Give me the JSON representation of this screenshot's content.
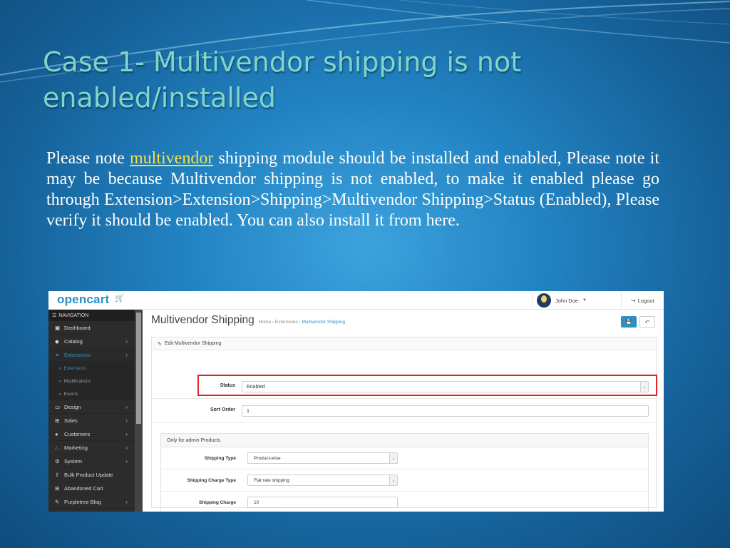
{
  "slide": {
    "title": "Case 1- Multivendor shipping is not enabled/installed",
    "body_before": "Please note ",
    "body_link": "multivendor",
    "body_after": " shipping module should be installed and enabled, Please note it may be because Multivendor shipping is not enabled, to make it enabled please go through Extension>Extension>Shipping>Multivendor Shipping>Status (Enabled), Please verify it should be enabled. You can also install it from here.",
    "link_color": "#f4e04d",
    "title_color": "#7fd6c8"
  },
  "app": {
    "logo": "opencart",
    "user_name": "John Doe",
    "logout_label": "Logout",
    "accent_color": "#2d90c8"
  },
  "sidebar": {
    "heading": "NAVIGATION",
    "items": [
      {
        "label": "Dashboard",
        "icon": "dashboard-icon",
        "arrow": false,
        "active": false
      },
      {
        "label": "Catalog",
        "icon": "tag-icon",
        "arrow": true,
        "active": false
      },
      {
        "label": "Extensions",
        "icon": "puzzle-icon",
        "arrow": true,
        "active": true
      },
      {
        "label": "Design",
        "icon": "monitor-icon",
        "arrow": true,
        "active": false
      },
      {
        "label": "Sales",
        "icon": "cart-icon",
        "arrow": true,
        "active": false
      },
      {
        "label": "Customers",
        "icon": "user-icon",
        "arrow": true,
        "active": false
      },
      {
        "label": "Marketing",
        "icon": "share-icon",
        "arrow": true,
        "active": false
      },
      {
        "label": "System",
        "icon": "cog-icon",
        "arrow": true,
        "active": false
      },
      {
        "label": "Bulk Product Update",
        "icon": "upload-icon",
        "arrow": false,
        "active": false
      },
      {
        "label": "Abandoned Cart",
        "icon": "cart-icon",
        "arrow": false,
        "active": false
      },
      {
        "label": "Purpletree Blog",
        "icon": "edit-icon",
        "arrow": true,
        "active": false
      }
    ],
    "subitems": [
      {
        "label": "Extensions",
        "active": true
      },
      {
        "label": "Modifications",
        "active": false
      },
      {
        "label": "Events",
        "active": false
      }
    ]
  },
  "page": {
    "title": "Multivendor Shipping",
    "breadcrumb": [
      "Home",
      "Extensions",
      "Multivendor Shipping"
    ],
    "panel_heading": "Edit Multivendor Shipping",
    "status_label": "Status",
    "status_value": "Enabled",
    "sort_order_label": "Sort Order",
    "sort_order_value": "1",
    "admin_section_heading": "Only for admin Products",
    "shipping_type_label": "Shipping Type",
    "shipping_type_value": "Product-wise",
    "charge_type_label": "Shipping Charge Type",
    "charge_type_value": "Flat rate shipping",
    "charge_label": "Shipping Charge",
    "charge_value": "10",
    "highlight_color": "#e02424"
  }
}
